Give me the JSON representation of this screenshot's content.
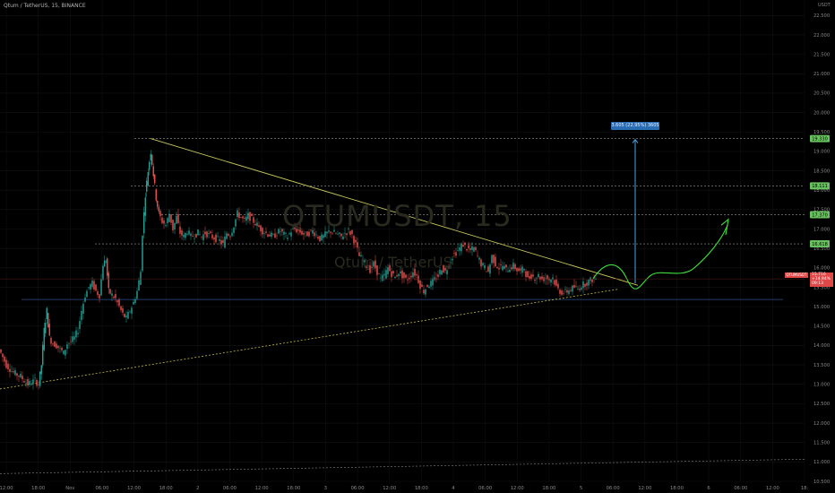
{
  "header": {
    "symbol_line": "Qtum / TetherUS, 15, BINANCE"
  },
  "watermark": {
    "ticker": "QTUMUSDT, 15",
    "name": "Qtum / TetherUS"
  },
  "price_axis_unit": "USDT",
  "chart_data": {
    "type": "candlestick",
    "title": "Qtum / TetherUS, 15, BINANCE",
    "xlabel": "",
    "ylabel": "",
    "ylim": [
      10.5,
      22.9
    ],
    "y_ticks": [
      "22.500",
      "22.000",
      "21.500",
      "21.000",
      "20.500",
      "20.000",
      "19.500",
      "19.000",
      "18.500",
      "18.000",
      "17.500",
      "17.000",
      "16.500",
      "16.000",
      "15.500",
      "15.000",
      "14.500",
      "14.000",
      "13.500",
      "13.000",
      "12.500",
      "12.000",
      "11.500",
      "11.000",
      "10.500"
    ],
    "x_ticks": [
      "12:00",
      "18:00",
      "Nov",
      "06:00",
      "12:00",
      "18:00",
      "2",
      "06:00",
      "12:00",
      "18:00",
      "3",
      "06:00",
      "12:00",
      "18:00",
      "4",
      "06:00",
      "12:00",
      "18:00",
      "5",
      "06:00",
      "12:00",
      "18:00",
      "6",
      "06:00",
      "12:00",
      "18:"
    ],
    "close_path": [
      [
        0,
        13.9
      ],
      [
        4,
        13.7
      ],
      [
        8,
        13.5
      ],
      [
        12,
        13.4
      ],
      [
        16,
        13.3
      ],
      [
        20,
        13.25
      ],
      [
        24,
        13.2
      ],
      [
        28,
        13.1
      ],
      [
        32,
        13.0
      ],
      [
        36,
        13.05
      ],
      [
        40,
        13.1
      ],
      [
        44,
        13.0
      ],
      [
        47,
        13.5
      ],
      [
        50,
        14.4
      ],
      [
        53,
        14.9
      ],
      [
        56,
        14.2
      ],
      [
        60,
        14.05
      ],
      [
        64,
        14.0
      ],
      [
        68,
        13.9
      ],
      [
        72,
        13.8
      ],
      [
        76,
        14.05
      ],
      [
        80,
        14.1
      ],
      [
        84,
        14.2
      ],
      [
        88,
        14.4
      ],
      [
        92,
        14.9
      ],
      [
        96,
        15.3
      ],
      [
        100,
        15.5
      ],
      [
        104,
        15.6
      ],
      [
        108,
        15.4
      ],
      [
        112,
        15.3
      ],
      [
        116,
        16.1
      ],
      [
        119,
        16.2
      ],
      [
        122,
        15.4
      ],
      [
        126,
        15.3
      ],
      [
        130,
        15.2
      ],
      [
        134,
        15.0
      ],
      [
        138,
        14.8
      ],
      [
        142,
        14.7
      ],
      [
        146,
        14.9
      ],
      [
        150,
        15.1
      ],
      [
        154,
        15.4
      ],
      [
        158,
        15.9
      ],
      [
        160,
        16.9
      ],
      [
        163,
        17.9
      ],
      [
        166,
        18.5
      ],
      [
        169,
        19.0
      ],
      [
        172,
        18.4
      ],
      [
        175,
        17.8
      ],
      [
        178,
        17.4
      ],
      [
        182,
        17.2
      ],
      [
        186,
        17.1
      ],
      [
        190,
        17.4
      ],
      [
        194,
        17.0
      ],
      [
        198,
        17.3
      ],
      [
        202,
        16.9
      ],
      [
        206,
        16.8
      ],
      [
        210,
        16.95
      ],
      [
        214,
        16.8
      ],
      [
        218,
        16.85
      ],
      [
        222,
        16.9
      ],
      [
        226,
        16.8
      ],
      [
        230,
        16.9
      ],
      [
        234,
        16.85
      ],
      [
        238,
        16.8
      ],
      [
        242,
        16.75
      ],
      [
        246,
        16.7
      ],
      [
        250,
        16.6
      ],
      [
        254,
        16.9
      ],
      [
        258,
        16.85
      ],
      [
        262,
        17.1
      ],
      [
        266,
        17.4
      ],
      [
        270,
        17.3
      ],
      [
        274,
        17.2
      ],
      [
        278,
        17.35
      ],
      [
        282,
        17.25
      ],
      [
        286,
        17.15
      ],
      [
        290,
        17.05
      ],
      [
        294,
        16.95
      ],
      [
        298,
        16.9
      ],
      [
        302,
        16.85
      ],
      [
        306,
        16.8
      ],
      [
        310,
        16.9
      ],
      [
        314,
        16.95
      ],
      [
        318,
        16.85
      ],
      [
        322,
        16.8
      ],
      [
        326,
        16.95
      ],
      [
        330,
        17.0
      ],
      [
        334,
        16.95
      ],
      [
        338,
        16.9
      ],
      [
        342,
        16.85
      ],
      [
        346,
        16.9
      ],
      [
        350,
        16.95
      ],
      [
        354,
        16.85
      ],
      [
        358,
        16.75
      ],
      [
        362,
        16.8
      ],
      [
        366,
        16.9
      ],
      [
        370,
        16.95
      ],
      [
        374,
        16.9
      ],
      [
        378,
        16.85
      ],
      [
        382,
        16.8
      ],
      [
        386,
        16.9
      ],
      [
        390,
        16.95
      ],
      [
        394,
        16.85
      ],
      [
        398,
        16.6
      ],
      [
        402,
        16.3
      ],
      [
        406,
        16.2
      ],
      [
        410,
        16.05
      ],
      [
        414,
        15.95
      ],
      [
        418,
        16.1
      ],
      [
        422,
        15.9
      ],
      [
        426,
        15.7
      ],
      [
        430,
        15.8
      ],
      [
        434,
        16.0
      ],
      [
        438,
        15.85
      ],
      [
        442,
        15.75
      ],
      [
        446,
        15.9
      ],
      [
        450,
        15.8
      ],
      [
        454,
        15.7
      ],
      [
        458,
        15.75
      ],
      [
        462,
        15.9
      ],
      [
        466,
        15.8
      ],
      [
        470,
        15.55
      ],
      [
        474,
        15.4
      ],
      [
        478,
        15.55
      ],
      [
        482,
        15.6
      ],
      [
        486,
        15.7
      ],
      [
        490,
        15.8
      ],
      [
        494,
        16.0
      ],
      [
        498,
        15.9
      ],
      [
        502,
        16.1
      ],
      [
        506,
        16.3
      ],
      [
        510,
        16.4
      ],
      [
        514,
        16.5
      ],
      [
        518,
        16.6
      ],
      [
        522,
        16.5
      ],
      [
        526,
        16.45
      ],
      [
        530,
        16.5
      ],
      [
        534,
        16.3
      ],
      [
        538,
        16.1
      ],
      [
        542,
        16.0
      ],
      [
        546,
        15.9
      ],
      [
        550,
        16.3
      ],
      [
        554,
        16.1
      ],
      [
        558,
        16.0
      ],
      [
        562,
        16.05
      ],
      [
        566,
        15.95
      ],
      [
        570,
        16.0
      ],
      [
        574,
        16.05
      ],
      [
        578,
        15.95
      ],
      [
        582,
        15.9
      ],
      [
        586,
        16.0
      ],
      [
        590,
        15.7
      ],
      [
        594,
        15.8
      ],
      [
        598,
        15.75
      ],
      [
        602,
        15.8
      ],
      [
        606,
        15.7
      ],
      [
        610,
        15.75
      ],
      [
        614,
        15.7
      ],
      [
        618,
        15.75
      ],
      [
        622,
        15.5
      ],
      [
        626,
        15.4
      ],
      [
        630,
        15.35
      ],
      [
        634,
        15.4
      ],
      [
        638,
        15.45
      ],
      [
        642,
        15.5
      ],
      [
        646,
        15.45
      ],
      [
        650,
        15.55
      ],
      [
        654,
        15.6
      ],
      [
        658,
        15.65
      ],
      [
        662,
        15.7
      ],
      [
        666,
        15.72
      ]
    ],
    "levels": [
      19.33,
      18.111,
      17.37,
      16.618,
      15.185
    ],
    "measure": {
      "label": "3.605 (22.95%) 3605"
    },
    "price_tags": [
      "19.330",
      "18.111",
      "17.370",
      "16.618"
    ],
    "last_price": {
      "symbol": "QTUMUSDT",
      "lines": [
        "15.716",
        "+14.94%",
        "09:13"
      ]
    },
    "colors": {
      "up": "#26a69a",
      "down": "#ef5350",
      "wick": "#9a9a9a",
      "trend": "#c8c85a",
      "dash_green": "#6fbf4a",
      "projection": "#3ee03e",
      "measure": "#4aa3e0",
      "support": "#2d4f8a",
      "badge": "#67c15e"
    },
    "grid": true
  }
}
